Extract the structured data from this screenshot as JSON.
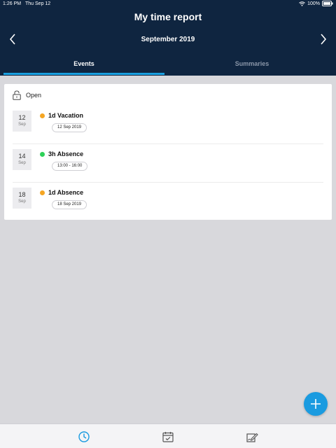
{
  "status_bar": {
    "time": "1:26 PM",
    "date": "Thu Sep 12",
    "battery": "100%"
  },
  "header": {
    "title": "My time report",
    "month": "September 2019"
  },
  "tabs": [
    {
      "label": "Events",
      "active": true
    },
    {
      "label": "Summaries",
      "active": false
    }
  ],
  "card": {
    "status_label": "Open",
    "events": [
      {
        "day": "12",
        "month": "Sep",
        "title": "1d Vacation",
        "detail": "12 Sep 2019",
        "dot_color": "#f5a623"
      },
      {
        "day": "14",
        "month": "Sep",
        "title": "3h Absence",
        "detail": "13:00 - 16:00",
        "dot_color": "#2ed158"
      },
      {
        "day": "18",
        "month": "Sep",
        "title": "1d Absence",
        "detail": "18 Sep 2019",
        "dot_color": "#f5a623"
      }
    ]
  },
  "colors": {
    "header_bg": "#0f2540",
    "accent": "#1a9be0",
    "page_bg": "#d8d8dc"
  },
  "icons": {
    "fab": "plus-icon",
    "bottom_nav": [
      "clock-icon",
      "calendar-check-icon",
      "signature-icon"
    ]
  }
}
